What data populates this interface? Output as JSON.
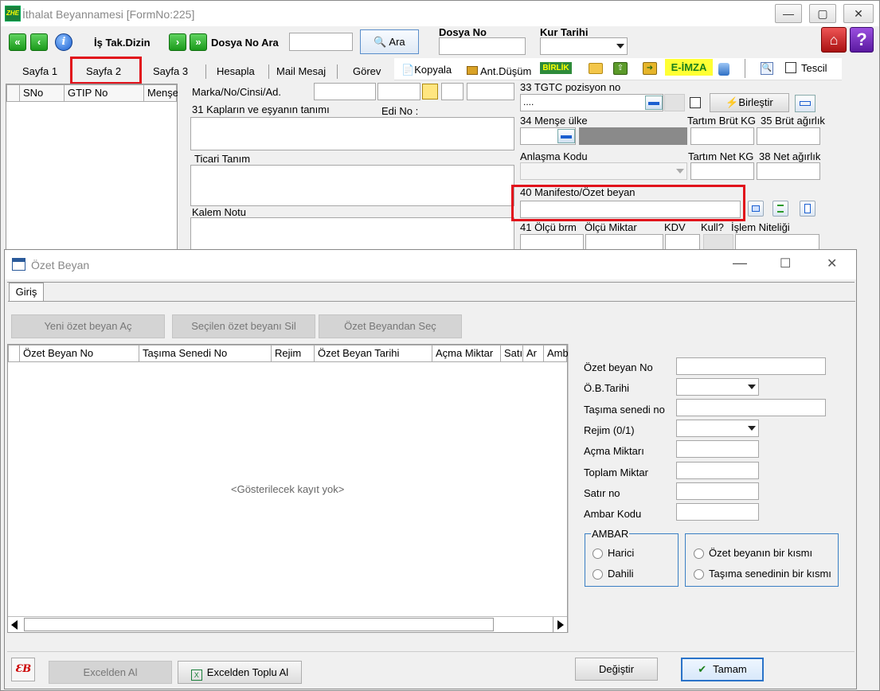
{
  "window": {
    "title": "İthalat Beyannamesi [FormNo:225]",
    "app_icon_text": "ZHE"
  },
  "toolbar": {
    "is_takip": "İş Tak.Dizin",
    "dosya_no_ara": "Dosya No Ara",
    "ara_button": "Ara",
    "dosya_no_label": "Dosya No",
    "kur_tarihi_label": "Kur Tarihi"
  },
  "tabs": [
    "Sayfa 1",
    "Sayfa 2",
    "Sayfa 3",
    "Hesapla",
    "Mail Mesaj",
    "Görev"
  ],
  "tools": {
    "kopyala": "Kopyala",
    "ant_dusum": "Ant.Düşüm",
    "birlik": "BİRLİK",
    "e_imza": "E-İMZA",
    "tescil": "Tescil"
  },
  "left_grid": {
    "columns": [
      "SNo",
      "GTIP No",
      "Menşe"
    ]
  },
  "form": {
    "marka": "Marka/No/Cinsi/Ad.",
    "kaplar": "31 Kapların ve eşyanın tanımı",
    "edi_no": "Edi No :",
    "ticari_tanim": "Ticari Tanım",
    "kalem_notu": "Kalem Notu",
    "gtc": "33 TGTC pozisyon no",
    "gtc_value": "....",
    "birlestir": "Birleştir",
    "mense_ulke": "34 Menşe ülke",
    "tartim_brut": "Tartım Brüt KG",
    "brut_agirlik": "35 Brüt ağırlık",
    "anlasma": "Anlaşma Kodu",
    "tartim_net": "Tartım Net KG",
    "net_agirlik": "38 Net ağırlık",
    "manifesto": "40 Manifesto/Özet beyan",
    "olcu_brm": "41 Ölçü brm",
    "olcu_miktar": "Ölçü Miktar",
    "kdv": "KDV",
    "kull": "Kull?",
    "islem_niteligi": "İşlem Niteliği"
  },
  "dialog": {
    "title": "Özet Beyan",
    "tab": "Giriş",
    "btn_yeni": "Yeni özet beyan Aç",
    "btn_sil": "Seçilen özet beyanı Sil",
    "btn_sec": "Özet Beyandan Seç",
    "columns": [
      "Özet Beyan No",
      "Taşıma Senedi No",
      "Rejim",
      "Özet Beyan Tarihi",
      "Açma Miktar",
      "Satı",
      "Ar",
      "Amb"
    ],
    "empty": "<Gösterilecek kayıt yok>",
    "fields": {
      "ozet_no": "Özet beyan No",
      "ob_tarihi": "Ö.B.Tarihi",
      "tasima_no": "Taşıma senedi no",
      "rejim": "Rejim  (0/1)",
      "acma": "Açma Miktarı",
      "toplam": "Toplam Miktar",
      "satir": "Satır no",
      "ambar": "Ambar Kodu"
    },
    "ambar_group": "AMBAR",
    "harici": "Harici",
    "dahili": "Dahili",
    "ozet_kismi": "Özet beyanın bir kısmı",
    "tasima_kismi": "Taşıma senedinin bir kısmı",
    "excelden": "Excelden Al",
    "excelden_toplu": "Excelden Toplu Al",
    "degistir": "Değiştir",
    "tamam": "Tamam"
  },
  "colors": {
    "highlight": "#e1111b",
    "accent": "#2a73c9"
  }
}
